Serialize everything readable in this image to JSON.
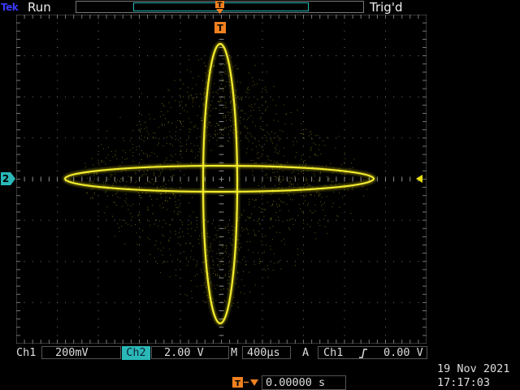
{
  "header": {
    "logo": "Tek",
    "run_state": "Run",
    "trigger_status": "Trig'd",
    "trigger_marker": "T"
  },
  "screen": {
    "ch2_marker": "2",
    "ch2_color": "#2ab8b8",
    "trace_color": "#e8e010",
    "trigger_marker_color": "#f08020"
  },
  "status": {
    "ch1_label": "Ch1",
    "ch1_scale": "200mV",
    "ch2_label": "Ch2",
    "ch2_scale": "2.00 V",
    "timebase_label": "M",
    "timebase": "400µs",
    "trigger_mode": "A",
    "trigger_source": "Ch1",
    "trigger_slope_icon": "rising-edge-icon",
    "trigger_level": "0.00 V",
    "trigger_offset": "0.00000 s"
  },
  "datetime": {
    "date": "19 Nov 2021",
    "time": "17:17:03"
  }
}
